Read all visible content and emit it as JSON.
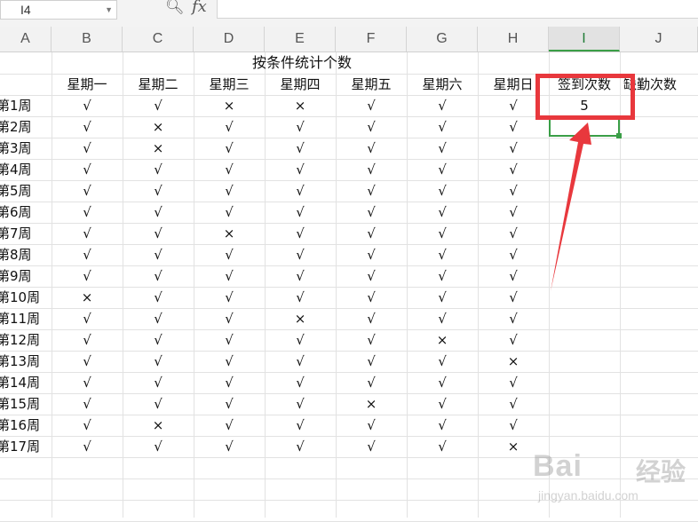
{
  "name_box": "I4",
  "formula_bar": {
    "fx_label": "fx",
    "content": ""
  },
  "columns": [
    "A",
    "B",
    "C",
    "D",
    "E",
    "F",
    "G",
    "H",
    "I",
    "J"
  ],
  "selected_column": "I",
  "sheet": {
    "title": "按条件统计个数",
    "days": [
      "星期一",
      "星期二",
      "星期三",
      "星期四",
      "星期五",
      "星期六",
      "星期日"
    ],
    "count_header": "签到次数",
    "absent_header": "缺勤次数",
    "rows": [
      {
        "week": "第1周",
        "marks": [
          "√",
          "√",
          "×",
          "×",
          "√",
          "√",
          "√"
        ],
        "count": "5"
      },
      {
        "week": "第2周",
        "marks": [
          "√",
          "×",
          "√",
          "√",
          "√",
          "√",
          "√"
        ],
        "count": ""
      },
      {
        "week": "第3周",
        "marks": [
          "√",
          "×",
          "√",
          "√",
          "√",
          "√",
          "√"
        ],
        "count": ""
      },
      {
        "week": "第4周",
        "marks": [
          "√",
          "√",
          "√",
          "√",
          "√",
          "√",
          "√"
        ],
        "count": ""
      },
      {
        "week": "第5周",
        "marks": [
          "√",
          "√",
          "√",
          "√",
          "√",
          "√",
          "√"
        ],
        "count": ""
      },
      {
        "week": "第6周",
        "marks": [
          "√",
          "√",
          "√",
          "√",
          "√",
          "√",
          "√"
        ],
        "count": ""
      },
      {
        "week": "第7周",
        "marks": [
          "√",
          "√",
          "×",
          "√",
          "√",
          "√",
          "√"
        ],
        "count": ""
      },
      {
        "week": "第8周",
        "marks": [
          "√",
          "√",
          "√",
          "√",
          "√",
          "√",
          "√"
        ],
        "count": ""
      },
      {
        "week": "第9周",
        "marks": [
          "√",
          "√",
          "√",
          "√",
          "√",
          "√",
          "√"
        ],
        "count": ""
      },
      {
        "week": "第10周",
        "marks": [
          "×",
          "√",
          "√",
          "√",
          "√",
          "√",
          "√"
        ],
        "count": ""
      },
      {
        "week": "第11周",
        "marks": [
          "√",
          "√",
          "√",
          "×",
          "√",
          "√",
          "√"
        ],
        "count": ""
      },
      {
        "week": "第12周",
        "marks": [
          "√",
          "√",
          "√",
          "√",
          "√",
          "×",
          "√"
        ],
        "count": ""
      },
      {
        "week": "第13周",
        "marks": [
          "√",
          "√",
          "√",
          "√",
          "√",
          "√",
          "×"
        ],
        "count": ""
      },
      {
        "week": "第14周",
        "marks": [
          "√",
          "√",
          "√",
          "√",
          "√",
          "√",
          "√"
        ],
        "count": ""
      },
      {
        "week": "第15周",
        "marks": [
          "√",
          "√",
          "√",
          "√",
          "×",
          "√",
          "√"
        ],
        "count": ""
      },
      {
        "week": "第16周",
        "marks": [
          "√",
          "×",
          "√",
          "√",
          "√",
          "√",
          "√"
        ],
        "count": ""
      },
      {
        "week": "第17周",
        "marks": [
          "√",
          "√",
          "√",
          "√",
          "√",
          "√",
          "×"
        ],
        "count": ""
      }
    ]
  },
  "watermark": {
    "brand": "Bai",
    "brand_cn": "经验",
    "url": "jingyan.baidu.com"
  },
  "colors": {
    "accent_green": "#3a9e47",
    "highlight_red": "#e8383d"
  },
  "icons": {
    "zoom": "magnifier-icon",
    "dropdown": "chevron-down-icon"
  }
}
